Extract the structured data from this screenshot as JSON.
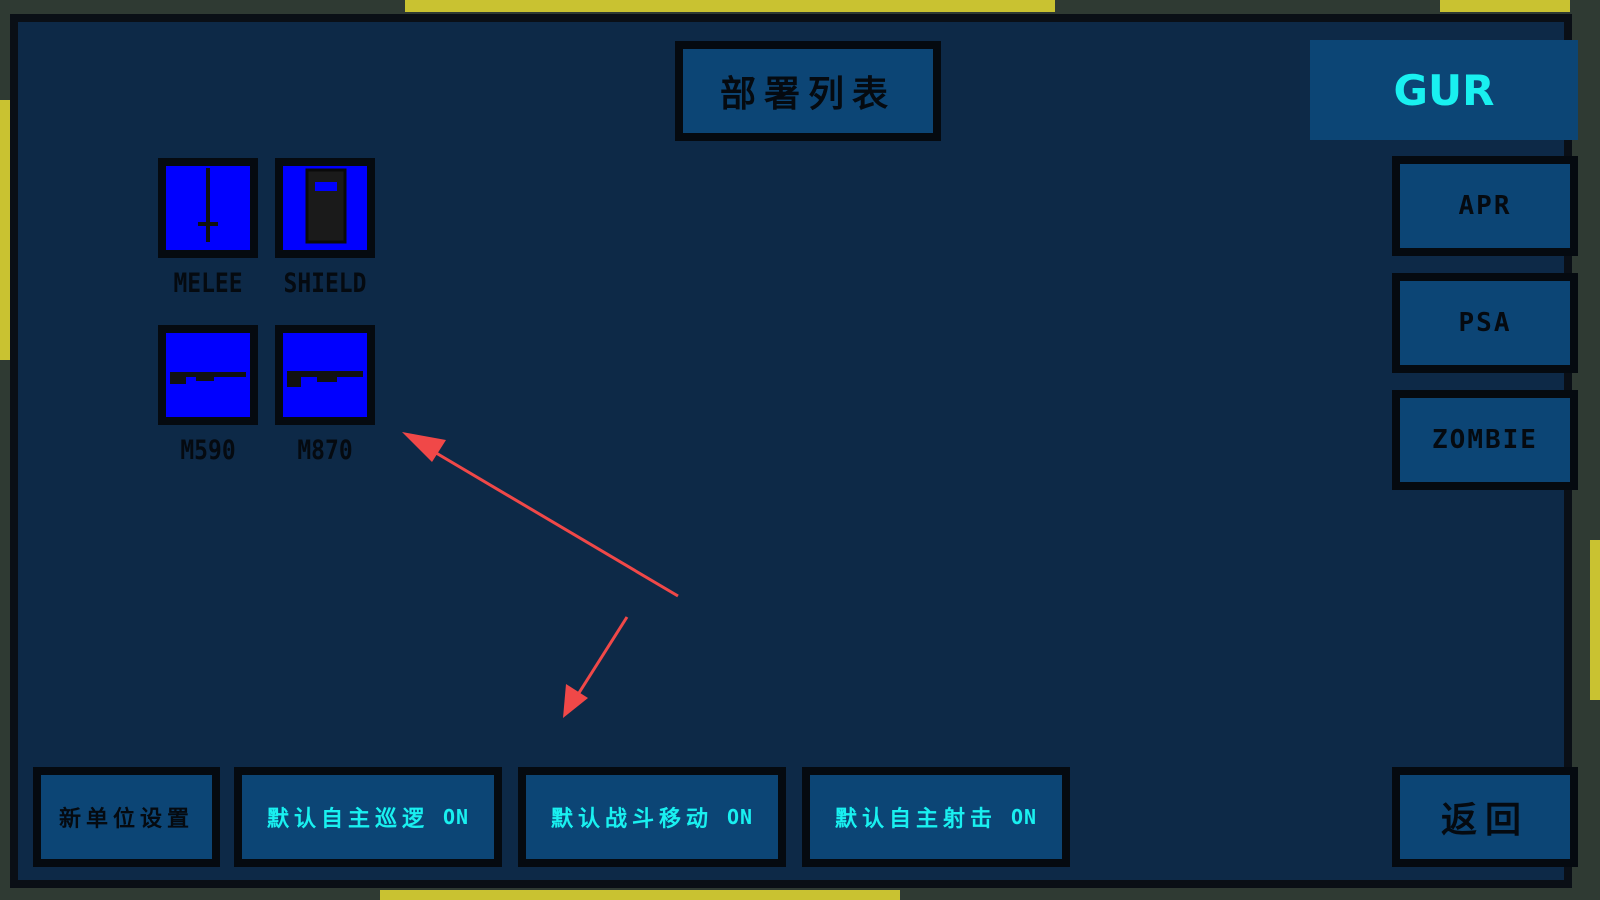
{
  "header": {
    "title": "部署列表",
    "faction": "GUR"
  },
  "weapons": [
    {
      "label": "MELEE",
      "icon": "baton-icon"
    },
    {
      "label": "SHIELD",
      "icon": "riot-shield-icon"
    },
    {
      "label": "M590",
      "icon": "shotgun-icon"
    },
    {
      "label": "M870",
      "icon": "shotgun-icon"
    }
  ],
  "factions": [
    {
      "label": "APR"
    },
    {
      "label": "PSA"
    },
    {
      "label": "ZOMBIE"
    }
  ],
  "bottom_bar": {
    "new_unit_settings": "新单位设置",
    "auto_patrol": {
      "label": "默认自主巡逻",
      "state": "ON"
    },
    "combat_move": {
      "label": "默认战斗移动",
      "state": "ON"
    },
    "auto_fire": {
      "label": "默认自主射击",
      "state": "ON"
    },
    "back": "返回"
  },
  "colors": {
    "panel_bg": "#0d2947",
    "button_bg": "#0c4575",
    "accent_cyan": "#19f0f0",
    "weapon_tile": "#0000ff",
    "annotation_arrow": "#f04848"
  }
}
